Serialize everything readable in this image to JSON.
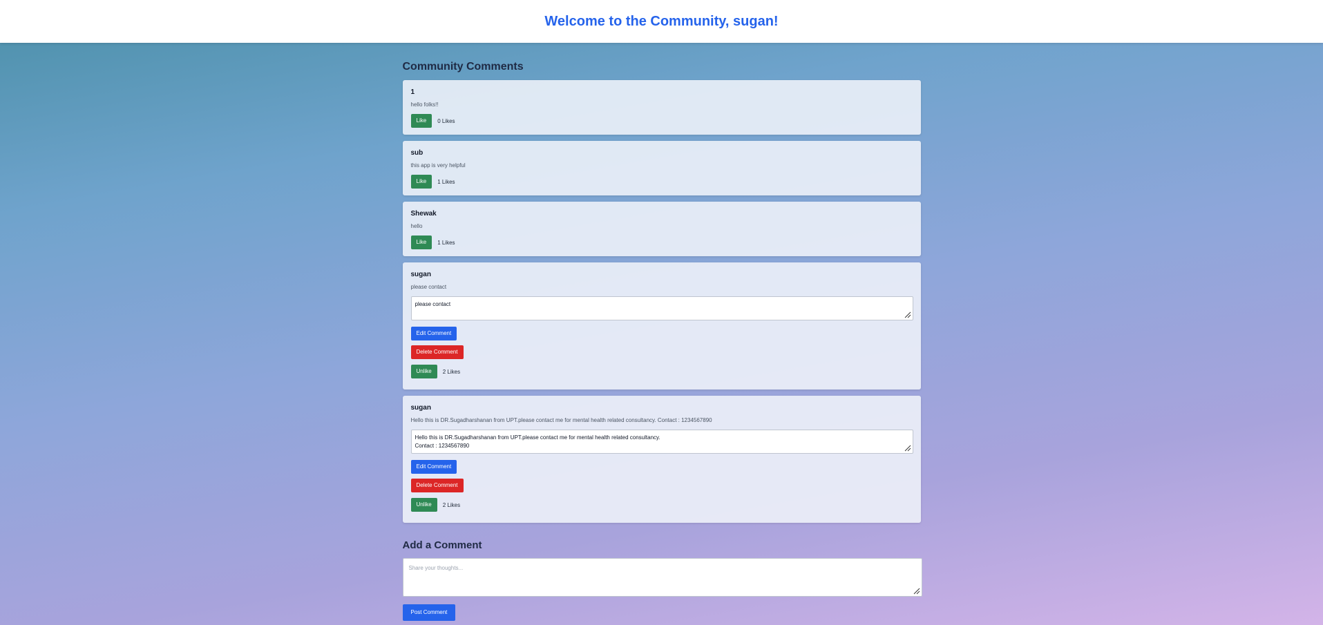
{
  "header": {
    "title": "Welcome to the Community, sugan!"
  },
  "comments_section": {
    "title": "Community Comments"
  },
  "comments": [
    {
      "author": "1",
      "text": "hello folks!!",
      "like_label": "Like",
      "likes": "0 Likes"
    },
    {
      "author": "sub",
      "text": "this app is very helpful",
      "like_label": "Like",
      "likes": "1 Likes"
    },
    {
      "author": "Shewak",
      "text": "hello",
      "like_label": "Like",
      "likes": "1 Likes"
    },
    {
      "author": "sugan",
      "text": "please contact",
      "edit_value": "please contact",
      "edit_label": "Edit Comment",
      "delete_label": "Delete Comment",
      "like_label": "Unlike",
      "likes": "2 Likes"
    },
    {
      "author": "sugan",
      "text": "Hello this is DR.Sugadharshanan from UPT.please contact me for mental health related consultancy. Contact : 1234567890",
      "edit_value": "Hello this is DR.Sugadharshanan from UPT.please contact me for mental health related consultancy.\nContact : 1234567890",
      "edit_label": "Edit Comment",
      "delete_label": "Delete Comment",
      "like_label": "Unlike",
      "likes": "2 Likes"
    }
  ],
  "add_comment": {
    "title": "Add a Comment",
    "placeholder": "Share your thoughts...",
    "post_label": "Post Comment"
  },
  "colors": {
    "accent": "#2563eb",
    "like": "#2f8a55",
    "delete": "#dc2626"
  }
}
